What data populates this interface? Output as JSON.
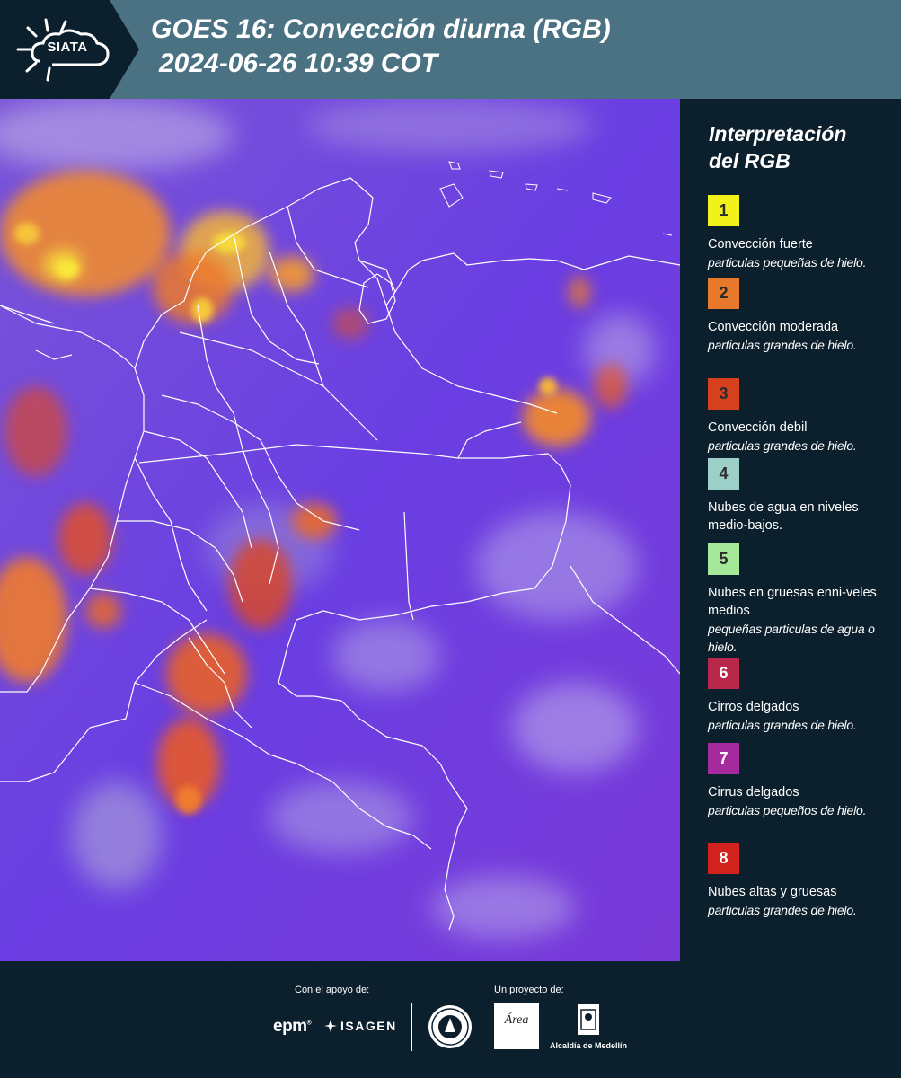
{
  "header": {
    "logo_text": "SIATA",
    "title_line1": "GOES 16: Convección diurna (RGB)",
    "title_line2": "2024-06-26 10:39 COT",
    "background": "#4a7283"
  },
  "map": {
    "base_color": "#6a3fe0",
    "border_color": "#ffffff"
  },
  "legend": {
    "title_line1": "Interpretación",
    "title_line2": "del RGB",
    "items": [
      {
        "num": "1",
        "color": "#f2f21a",
        "text_color": "#2b2b2b",
        "name": "Convección fuerte",
        "desc": "particulas pequeñas de hielo."
      },
      {
        "num": "2",
        "color": "#e8782a",
        "text_color": "#2b2b2b",
        "name": "Convección moderada",
        "desc": "particulas grandes de hielo."
      },
      {
        "num": "3",
        "color": "#d6401f",
        "text_color": "#2b2b2b",
        "name": "Convección debil",
        "desc": "particulas grandes de hielo."
      },
      {
        "num": "4",
        "color": "#9ccfc8",
        "text_color": "#2b2b2b",
        "name": "Nubes de agua en niveles medio-bajos.",
        "desc": ""
      },
      {
        "num": "5",
        "color": "#a6e89a",
        "text_color": "#2b2b2b",
        "name": "Nubes en gruesas enni-veles medios",
        "desc": "pequeñas particulas de agua o hielo."
      },
      {
        "num": "6",
        "color": "#b8284a",
        "text_color": "#ffffff",
        "name": "Cirros delgados",
        "desc": "particulas grandes de hielo."
      },
      {
        "num": "7",
        "color": "#a52a9e",
        "text_color": "#ffffff",
        "name": "Cirrus delgados",
        "desc": "particulas pequeños de hielo."
      },
      {
        "num": "8",
        "color": "#d1231c",
        "text_color": "#ffffff",
        "name": "Nubes altas y gruesas",
        "desc": "particulas grandes de hielo."
      }
    ]
  },
  "footer": {
    "support_label": "Con el apoyo de:",
    "project_label": "Un proyecto de:",
    "epm": "epm",
    "isagen": "ISAGEN",
    "metro_text": "Área",
    "alcaldia": "Alcaldía de Medellín"
  }
}
